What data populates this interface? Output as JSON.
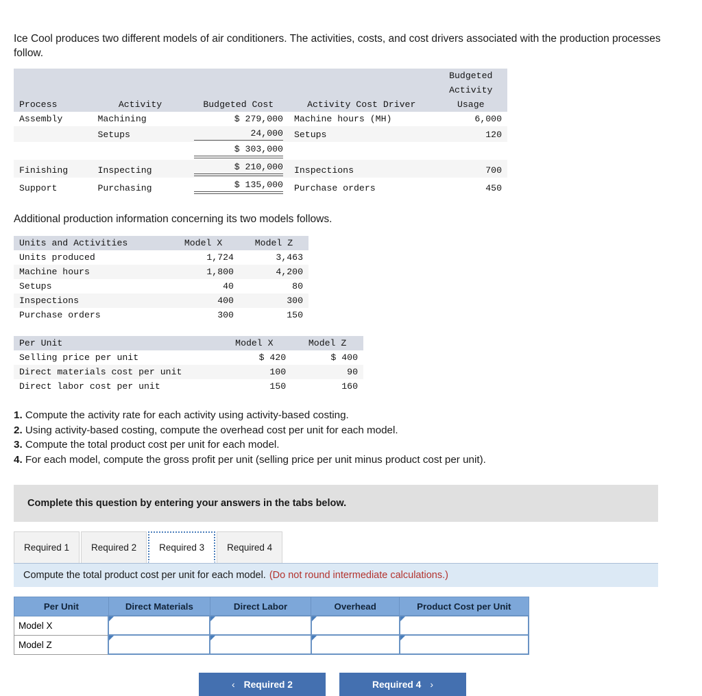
{
  "intro": {
    "paragraph1": "Ice Cool produces two different models of air conditioners. The activities, costs, and cost drivers associated with the production processes follow.",
    "paragraph2": "Additional production information concerning its two models follows."
  },
  "process_table": {
    "headers": [
      "Process",
      "Activity",
      "Budgeted Cost",
      "Activity Cost Driver",
      "Budgeted\nActivity\nUsage"
    ],
    "header_cells": {
      "process": "Process",
      "activity": "Activity",
      "budgeted_cost": "Budgeted Cost",
      "activity_cost_driver": "Activity Cost Driver",
      "budgeted_activity_usage_l1": "Budgeted",
      "budgeted_activity_usage_l2": "Activity",
      "budgeted_activity_usage_l3": "Usage"
    },
    "rows": [
      {
        "process": "Assembly",
        "activity": "Machining",
        "cost": "$ 279,000",
        "driver": "Machine hours (MH)",
        "usage": "6,000"
      },
      {
        "process": "",
        "activity": "Setups",
        "cost": "24,000",
        "driver": "Setups",
        "usage": "120"
      },
      {
        "process": "",
        "activity": "",
        "cost": "$ 303,000",
        "driver": "",
        "usage": ""
      },
      {
        "process": "Finishing",
        "activity": "Inspecting",
        "cost": "$ 210,000",
        "driver": "Inspections",
        "usage": "700"
      },
      {
        "process": "Support",
        "activity": "Purchasing",
        "cost": "$ 135,000",
        "driver": "Purchase orders",
        "usage": "450"
      }
    ]
  },
  "units_table": {
    "headers": [
      "Units and Activities",
      "Model X",
      "Model Z"
    ],
    "rows": [
      {
        "label": "Units produced",
        "x": "1,724",
        "z": "3,463"
      },
      {
        "label": "Machine hours",
        "x": "1,800",
        "z": "4,200"
      },
      {
        "label": "Setups",
        "x": "40",
        "z": "80"
      },
      {
        "label": "Inspections",
        "x": "400",
        "z": "300"
      },
      {
        "label": "Purchase orders",
        "x": "300",
        "z": "150"
      }
    ]
  },
  "per_unit_table": {
    "headers": [
      "Per Unit",
      "Model X",
      "Model Z"
    ],
    "rows": [
      {
        "label": "Selling price per unit",
        "x": "$ 420",
        "z": "$ 400"
      },
      {
        "label": "Direct materials cost per unit",
        "x": "100",
        "z": "90"
      },
      {
        "label": "Direct labor cost per unit",
        "x": "150",
        "z": "160"
      }
    ]
  },
  "requirements": [
    {
      "num": "1.",
      "text": "Compute the activity rate for each activity using activity-based costing."
    },
    {
      "num": "2.",
      "text": "Using activity-based costing, compute the overhead cost per unit for each model."
    },
    {
      "num": "3.",
      "text": "Compute the total product cost per unit for each model."
    },
    {
      "num": "4.",
      "text": "For each model, compute the gross profit per unit (selling price per unit minus product cost per unit)."
    }
  ],
  "banner": {
    "text": "Complete this question by entering your answers in the tabs below."
  },
  "tabs": {
    "items": [
      {
        "label": "Required 1",
        "active": false
      },
      {
        "label": "Required 2",
        "active": false
      },
      {
        "label": "Required 3",
        "active": true
      },
      {
        "label": "Required 4",
        "active": false
      }
    ]
  },
  "subbar": {
    "instruction": "Compute the total product cost per unit for each model.",
    "note": "(Do not round intermediate calculations.)"
  },
  "answer_table": {
    "headers": [
      "Per Unit",
      "Direct Materials",
      "Direct Labor",
      "Overhead",
      "Product Cost per Unit"
    ],
    "rows": [
      {
        "label": "Model X",
        "direct_materials": "",
        "direct_labor": "",
        "overhead": "",
        "product_cost": ""
      },
      {
        "label": "Model Z",
        "direct_materials": "",
        "direct_labor": "",
        "overhead": "",
        "product_cost": ""
      }
    ]
  },
  "nav": {
    "prev_label": "Required 2",
    "next_label": "Required 4",
    "prev_chevron": "‹",
    "next_chevron": "›"
  },
  "colors": {
    "table_header": "#d7dbe4",
    "answer_header": "#7da7d9",
    "banner": "#e0e0e0",
    "subbar": "#dce9f5",
    "note_red": "#b3332e",
    "button_blue": "#4470b0",
    "accent": "#4a7ebb"
  }
}
